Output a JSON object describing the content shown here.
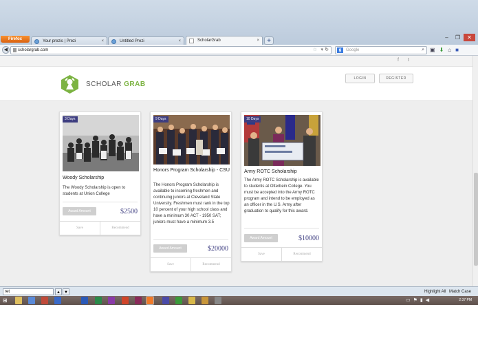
{
  "browser": {
    "menu_button": "Firefox",
    "tabs": [
      {
        "label": "Your prezis | Prezi"
      },
      {
        "label": "Untitled Prezi"
      },
      {
        "label": "ScholarGrab"
      }
    ],
    "new_tab": "+",
    "url": "scholargrab.com",
    "search_placeholder": "Google",
    "window_controls": [
      "–",
      "❐",
      "✕"
    ]
  },
  "site": {
    "logo_part1": "SCHOLAR",
    "logo_part2": "GRAB",
    "login": "LOGIN",
    "register": "REGISTER",
    "social": [
      "f",
      "t"
    ],
    "brand_color": "#7cb342",
    "accent_color": "#3d3d80"
  },
  "cards": [
    {
      "days": "3 Days",
      "title": "Woody Scholarship",
      "description": "The Woody Scholarship is open to students at Union College",
      "award_button": "Award Amount",
      "amount": "$2500",
      "save": "Save",
      "recommend": "Recommend"
    },
    {
      "days": "9 Days",
      "title": "Honors Program Scholarship - CSU",
      "description": "The Honors Program Scholarship is available to incoming freshmen and continuing juniors at Cleveland State University. Freshmen must rank in the top 10 percent of your high school class and have a minimum 30 ACT - 1950 SAT; juniors must have a minimum 3.5",
      "award_button": "Award Amount",
      "amount": "$20000",
      "save": "Save",
      "recommend": "Recommend"
    },
    {
      "days": "10 Days",
      "title": "Army ROTC Scholarship",
      "description": "The Army ROTC Scholarship is available to students at Otterbein College. You must be accepted into the Army ROTC program and intend to be employed as an officer in the U.S. Army after graduation to qualify for this award.",
      "award_button": "Award Amount",
      "amount": "$10000",
      "save": "Save",
      "recommend": "Recommend"
    }
  ],
  "findbar": {
    "query": "ret",
    "highlight_all": "Highlight All",
    "match_case": "Match Case"
  },
  "taskbar": {
    "clock": "2:37 PM"
  }
}
